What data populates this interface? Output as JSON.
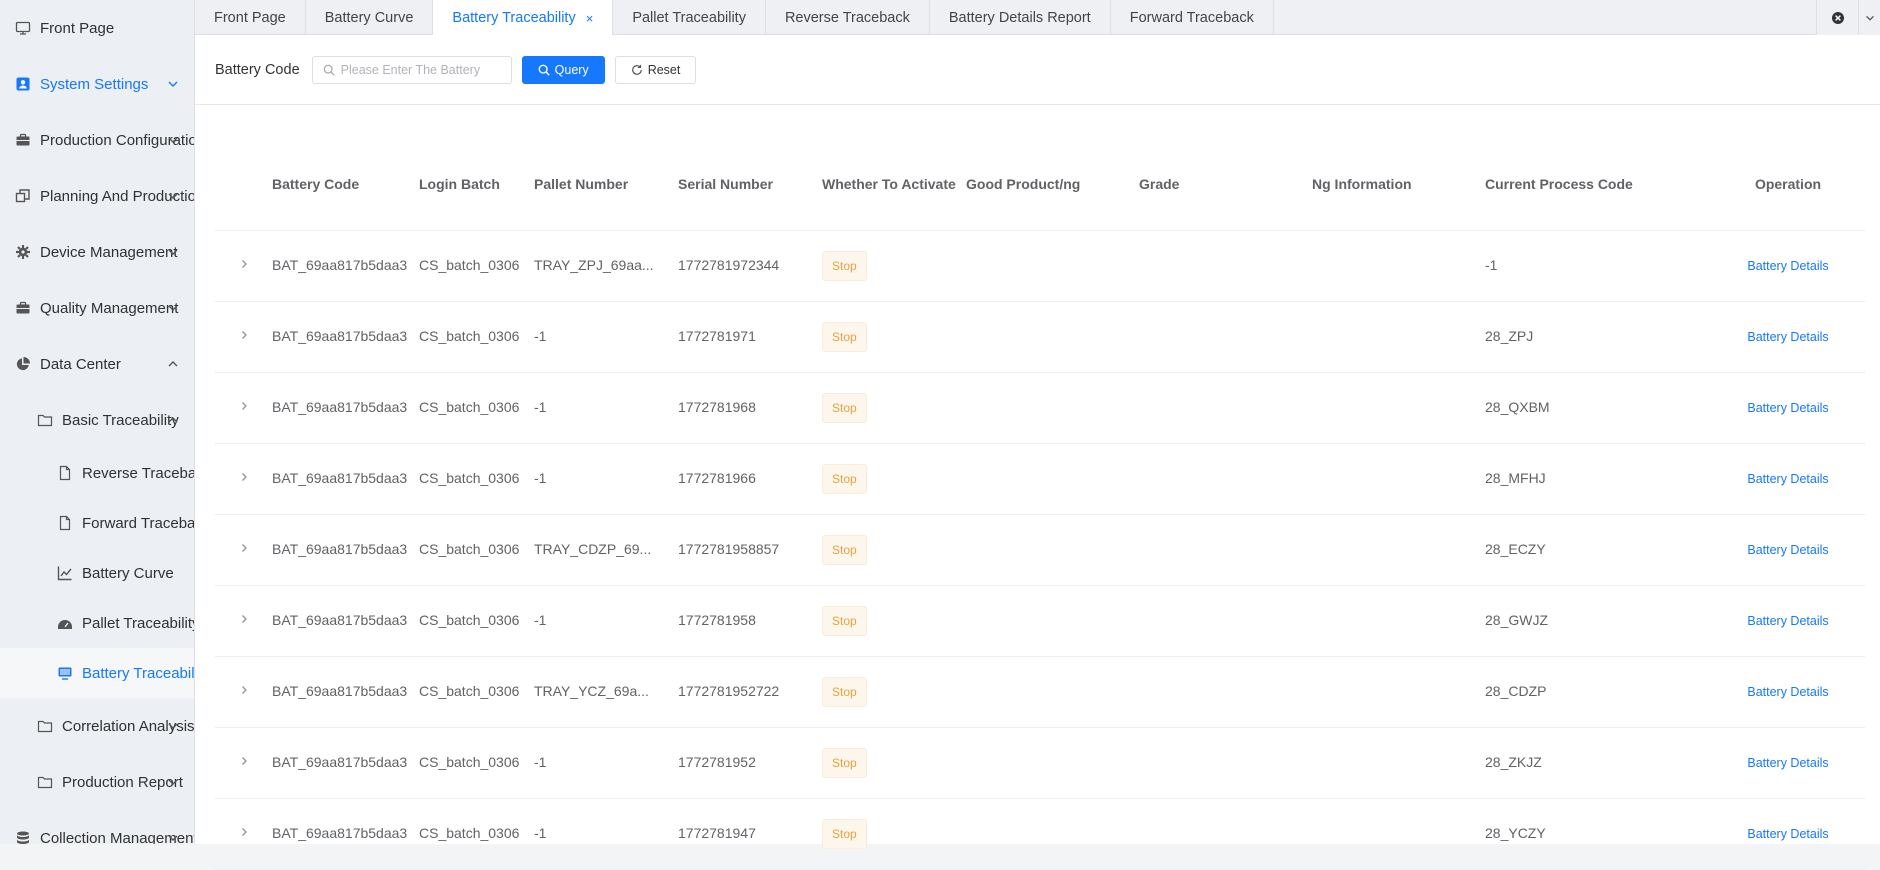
{
  "sidebar": {
    "items": [
      {
        "label": "Front Page",
        "icon": "monitor-icon"
      },
      {
        "label": "System Settings",
        "icon": "user-badge-icon"
      },
      {
        "label": "Production Configuration",
        "icon": "briefcase-icon"
      },
      {
        "label": "Planning And Production",
        "icon": "windows-icon"
      },
      {
        "label": "Device Management",
        "icon": "gear-icon"
      },
      {
        "label": "Quality Management",
        "icon": "briefcase-icon"
      },
      {
        "label": "Data Center",
        "icon": "pie-chart-icon"
      },
      {
        "label": "Basic Traceability",
        "icon": "folder-icon"
      },
      {
        "label": "Reverse Traceback",
        "icon": "file-icon"
      },
      {
        "label": "Forward Traceback",
        "icon": "file-icon"
      },
      {
        "label": "Battery Curve",
        "icon": "line-chart-icon"
      },
      {
        "label": "Pallet Traceability",
        "icon": "dashboard-icon"
      },
      {
        "label": "Battery Traceability",
        "icon": "monitor-icon"
      },
      {
        "label": "Correlation Analysis",
        "icon": "folder-icon"
      },
      {
        "label": "Production Report",
        "icon": "folder-icon"
      },
      {
        "label": "Collection Management",
        "icon": "database-icon"
      }
    ]
  },
  "tabs": [
    {
      "label": "Front Page"
    },
    {
      "label": "Battery Curve"
    },
    {
      "label": "Battery Traceability",
      "close": "×"
    },
    {
      "label": "Pallet Traceability"
    },
    {
      "label": "Reverse Traceback"
    },
    {
      "label": "Battery Details Report"
    },
    {
      "label": "Forward Traceback"
    }
  ],
  "search": {
    "label": "Battery Code",
    "placeholder": "Please Enter The Battery",
    "query_label": "Query",
    "reset_label": "Reset"
  },
  "table": {
    "headers": {
      "battery_code": "Battery Code",
      "login_batch": "Login Batch",
      "pallet_number": "Pallet Number",
      "serial_number": "Serial Number",
      "whether_to_activate": "Whether To Activate",
      "good_product": "Good Product/ng",
      "grade": "Grade",
      "ng_information": "Ng Information",
      "current_process_code": "Current Process Code",
      "operation": "Operation"
    },
    "rows": [
      {
        "battery_code": "BAT_69aa817b5daa3",
        "login_batch": "CS_batch_0306",
        "pallet_number": "TRAY_ZPJ_69aa...",
        "serial_number": "1772781972344",
        "status": "Stop",
        "good_product": "",
        "grade": "",
        "ng_information": "",
        "process_code": "-1",
        "operation": "Battery Details"
      },
      {
        "battery_code": "BAT_69aa817b5daa3",
        "login_batch": "CS_batch_0306",
        "pallet_number": "-1",
        "serial_number": "1772781971",
        "status": "Stop",
        "good_product": "",
        "grade": "",
        "ng_information": "",
        "process_code": "28_ZPJ",
        "operation": "Battery Details"
      },
      {
        "battery_code": "BAT_69aa817b5daa3",
        "login_batch": "CS_batch_0306",
        "pallet_number": "-1",
        "serial_number": "1772781968",
        "status": "Stop",
        "good_product": "",
        "grade": "",
        "ng_information": "",
        "process_code": "28_QXBM",
        "operation": "Battery Details"
      },
      {
        "battery_code": "BAT_69aa817b5daa3",
        "login_batch": "CS_batch_0306",
        "pallet_number": "-1",
        "serial_number": "1772781966",
        "status": "Stop",
        "good_product": "",
        "grade": "",
        "ng_information": "",
        "process_code": "28_MFHJ",
        "operation": "Battery Details"
      },
      {
        "battery_code": "BAT_69aa817b5daa3",
        "login_batch": "CS_batch_0306",
        "pallet_number": "TRAY_CDZP_69...",
        "serial_number": "1772781958857",
        "status": "Stop",
        "good_product": "",
        "grade": "",
        "ng_information": "",
        "process_code": "28_ECZY",
        "operation": "Battery Details"
      },
      {
        "battery_code": "BAT_69aa817b5daa3",
        "login_batch": "CS_batch_0306",
        "pallet_number": "-1",
        "serial_number": "1772781958",
        "status": "Stop",
        "good_product": "",
        "grade": "",
        "ng_information": "",
        "process_code": "28_GWJZ",
        "operation": "Battery Details"
      },
      {
        "battery_code": "BAT_69aa817b5daa3",
        "login_batch": "CS_batch_0306",
        "pallet_number": "TRAY_YCZ_69a...",
        "serial_number": "1772781952722",
        "status": "Stop",
        "good_product": "",
        "grade": "",
        "ng_information": "",
        "process_code": "28_CDZP",
        "operation": "Battery Details"
      },
      {
        "battery_code": "BAT_69aa817b5daa3",
        "login_batch": "CS_batch_0306",
        "pallet_number": "-1",
        "serial_number": "1772781952",
        "status": "Stop",
        "good_product": "",
        "grade": "",
        "ng_information": "",
        "process_code": "28_ZKJZ",
        "operation": "Battery Details"
      },
      {
        "battery_code": "BAT_69aa817b5daa3",
        "login_batch": "CS_batch_0306",
        "pallet_number": "-1",
        "serial_number": "1772781947",
        "status": "Stop",
        "good_product": "",
        "grade": "",
        "ng_information": "",
        "process_code": "28_YCZY",
        "operation": "Battery Details"
      }
    ]
  },
  "colors": {
    "accent": "#1677ff",
    "tag_warning_text": "#e6a23c",
    "tag_warning_bg": "#fdf6ec",
    "sidebar_bg": "#eceff3"
  }
}
